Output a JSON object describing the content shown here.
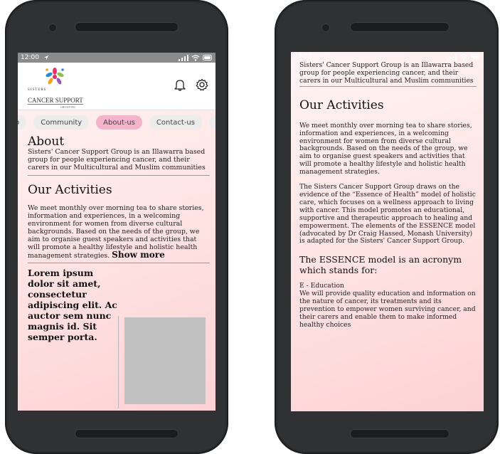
{
  "status": {
    "time": "12:00"
  },
  "logo": {
    "tagline": "SISTERS'",
    "name": "CANCER SUPPORT",
    "sub": "GROUP INC."
  },
  "tabs": [
    {
      "label": "eo"
    },
    {
      "label": "Community"
    },
    {
      "label": "About-us"
    },
    {
      "label": "Contact-us"
    }
  ],
  "about": {
    "title": "About",
    "text": "Sisters' Cancer Support Group is an Illawarra based group for people experiencing cancer, and their carers in our Multicultural and Muslim communities"
  },
  "activities": {
    "title": "Our Activities",
    "p1": "We meet monthly over morning tea to share stories, information and experiences, in a welcoming environment for women from diverse cultural backgrounds. Based on the needs of the group, we aim to organise guest speakers and activities that will promote a healthy lifestyle and holistic health management strategies.",
    "show_more": "Show more",
    "p2": "The Sisters Cancer Support Group draws on the evidence of the “Essence of Health” model of holistic care, which focuses on a wellness approach to living with cancer. This model promotes an educational, supportive and therapeutic approach to healing and empowerment. The elements of the ESSENCE model (advocated by Dr Craig Hassed, Monash University) is adapted for the Sisters' Cancer Support Group.",
    "essence_title": "The ESSENCE model is an acronym which stands for:",
    "e_title": "E - Education",
    "e_text": "We will provide quality education and information on the nature of cancer, its treatments and its prevention to empower women surviving cancer, and their carers and enable them to make informed healthy choices"
  },
  "lorem": "Lorem ipsum dolor sit amet, consectetur adipiscing elit. Ac auctor sem nunc magnis id. Sit semper porta.",
  "colors": {
    "active_tab": "#f5b4cb",
    "screen_bg": "#ffe4e4",
    "phone": "#2b2c2e"
  }
}
